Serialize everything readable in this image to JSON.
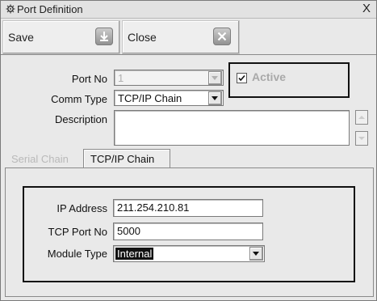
{
  "window": {
    "title": "Port Definition",
    "close_symbol": "X",
    "icon": "gear-icon"
  },
  "toolbar": {
    "save_label": "Save",
    "save_icon": "save-icon",
    "close_label": "Close",
    "close_icon": "close-icon"
  },
  "form": {
    "port_no_label": "Port No",
    "port_no_value": "1",
    "active_label": "Active",
    "active_checked": true,
    "comm_type_label": "Comm Type",
    "comm_type_value": "TCP/IP Chain",
    "description_label": "Description",
    "description_value": ""
  },
  "tabs": [
    {
      "label": "Serial Chain",
      "active": false
    },
    {
      "label": "TCP/IP Chain",
      "active": true
    }
  ],
  "tcpip": {
    "ip_address_label": "IP Address",
    "ip_address_value": "211.254.210.81",
    "tcp_port_label": "TCP Port No",
    "tcp_port_value": "5000",
    "module_type_label": "Module Type",
    "module_type_value": "Internal"
  },
  "colors": {
    "window_bg": "#e9e9e9",
    "highlight_border": "#111111",
    "disabled_text": "#b0b0b0"
  }
}
